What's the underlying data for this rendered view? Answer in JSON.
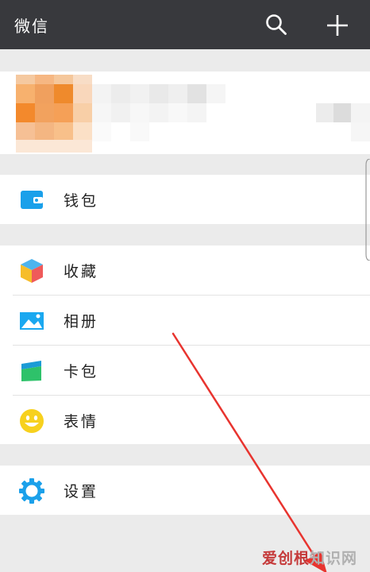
{
  "header": {
    "title": "微信"
  },
  "menu": {
    "wallet": "钱包",
    "favorites": "收藏",
    "album": "相册",
    "cards": "卡包",
    "stickers": "表情",
    "settings": "设置"
  },
  "watermark": {
    "brand": "爱创根",
    "site": "知识网"
  },
  "colors": {
    "topbar": "#38393d",
    "background": "#ebebeb",
    "accent_blue": "#1aa8f0",
    "annotation_arrow": "#e8342f"
  },
  "icons": {
    "search": "search-icon",
    "add": "plus-icon",
    "wallet": "wallet-icon",
    "favorites": "cube-icon",
    "album": "image-icon",
    "cards": "card-icon",
    "stickers": "smiley-icon",
    "settings": "gear-icon"
  }
}
